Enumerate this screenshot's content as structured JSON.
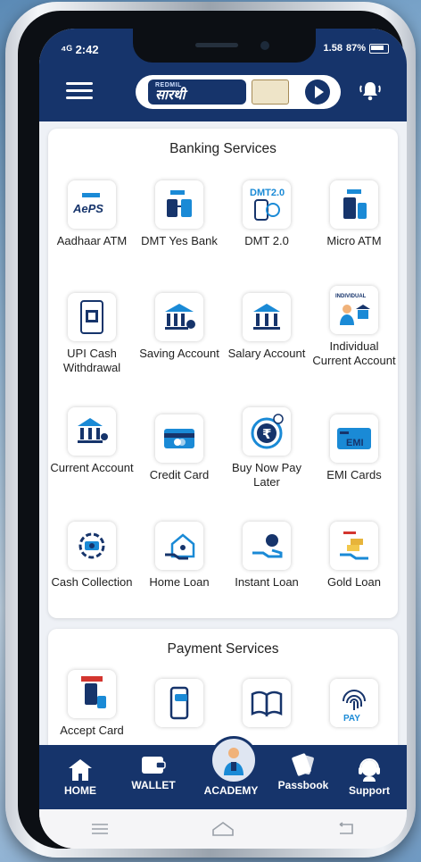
{
  "status": {
    "time": "2:42",
    "signal": "⁴ᴳ",
    "battery": "87%",
    "net": "1.58"
  },
  "header": {
    "brand_small": "REDMIL",
    "brand_big": "सारथी"
  },
  "banking": {
    "title": "Banking Services",
    "items": [
      {
        "label": "Aadhaar ATM",
        "icon": "aeps-icon"
      },
      {
        "label": "DMT Yes Bank",
        "icon": "dmt-yes-bank-icon"
      },
      {
        "label": "DMT 2.0",
        "icon": "dmt2-icon",
        "badge": "DMT2.0"
      },
      {
        "label": "Micro ATM",
        "icon": "micro-atm-icon"
      },
      {
        "label": "UPI Cash Withdrawal",
        "icon": "upi-cash-icon"
      },
      {
        "label": "Saving Account",
        "icon": "saving-account-icon"
      },
      {
        "label": "Salary Account",
        "icon": "salary-account-icon"
      },
      {
        "label": "Individual Current Account",
        "icon": "individual-current-icon",
        "badge": "INDIVIDUAL"
      },
      {
        "label": "Current Account",
        "icon": "current-account-icon"
      },
      {
        "label": "Credit Card",
        "icon": "credit-card-icon"
      },
      {
        "label": "Buy Now Pay Later",
        "icon": "bnpl-icon"
      },
      {
        "label": "EMI Cards",
        "icon": "emi-card-icon",
        "badge": "EMI"
      },
      {
        "label": "Cash Collection",
        "icon": "cash-collection-icon"
      },
      {
        "label": "Home Loan",
        "icon": "home-loan-icon"
      },
      {
        "label": "Instant Loan",
        "icon": "instant-loan-icon"
      },
      {
        "label": "Gold Loan",
        "icon": "gold-loan-icon"
      }
    ]
  },
  "payment": {
    "title": "Payment Services",
    "items": [
      {
        "label": "Accept Card",
        "icon": "accept-card-icon"
      },
      {
        "label": "",
        "icon": "mobile-sms-icon"
      },
      {
        "label": "",
        "icon": "book-icon"
      },
      {
        "label": "",
        "icon": "fingerprint-pay-icon",
        "badge": "PAY"
      }
    ]
  },
  "bottom_nav": [
    {
      "label": "HOME",
      "icon": "home-icon"
    },
    {
      "label": "WALLET",
      "icon": "wallet-icon"
    },
    {
      "label": "ACADEMY",
      "icon": "academy-icon"
    },
    {
      "label": "Passbook",
      "icon": "passbook-icon"
    },
    {
      "label": "Support",
      "icon": "support-icon"
    }
  ],
  "colors": {
    "primary": "#16346b",
    "accent": "#1a8ad6"
  }
}
